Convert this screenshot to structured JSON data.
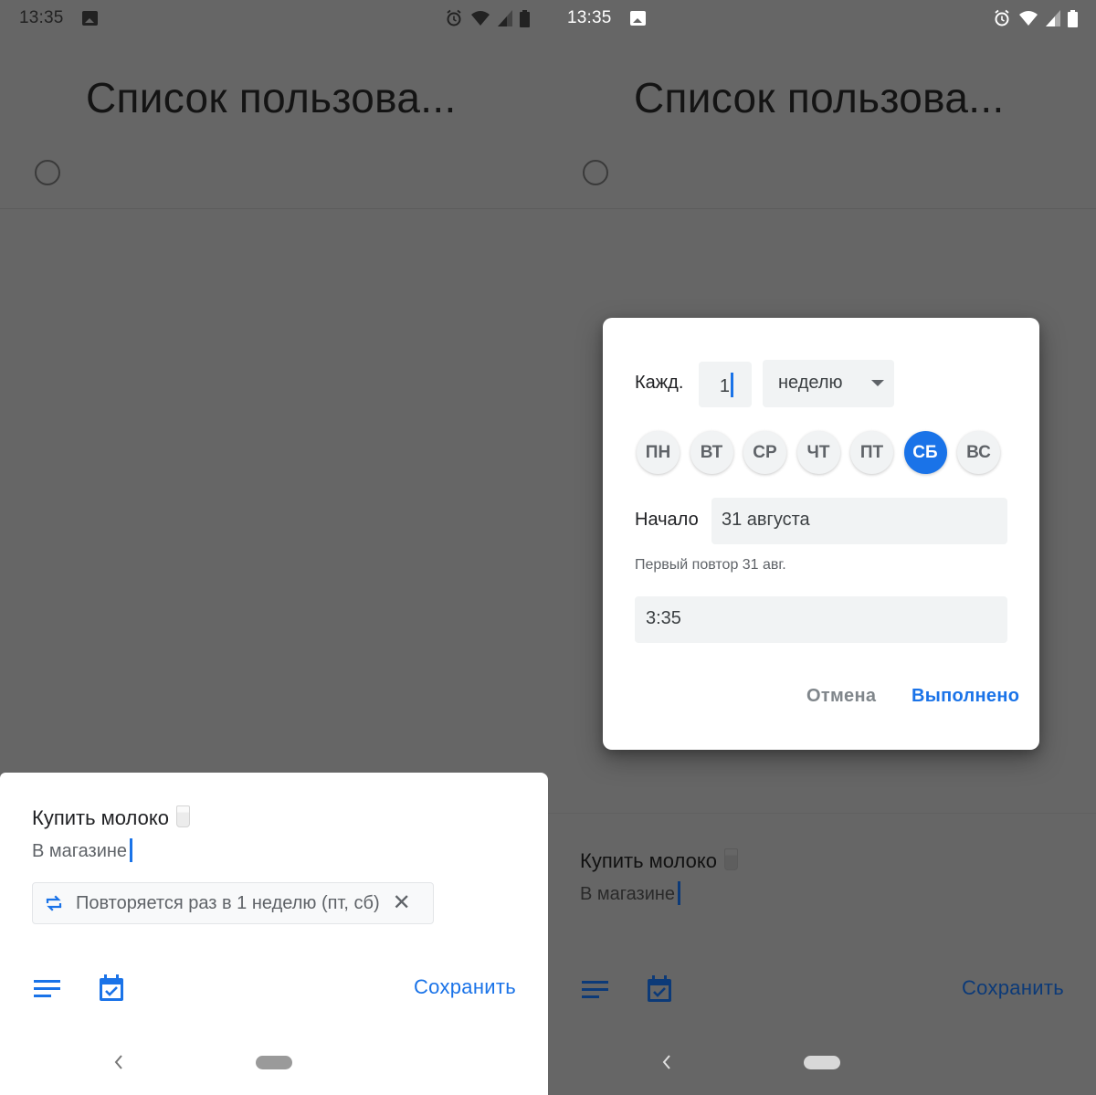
{
  "colors": {
    "accent": "#1a73e8",
    "scrim": "#666666",
    "chip_background": "#f1f3f4",
    "text_primary": "#202124",
    "text_secondary": "#5f6368"
  },
  "panels": [
    {
      "status_bar": {
        "time": "13:35",
        "icons": [
          "image-icon",
          "alarm-icon",
          "wifi-icon",
          "signal-icon",
          "battery-icon"
        ]
      },
      "list_title": "Список пользова...",
      "sheet": {
        "task_title": "Купить молоко",
        "task_emoji": "glass-of-milk-icon",
        "notes": "В магазине",
        "repeat_chip": {
          "icon": "repeat-icon",
          "label": "Повторяется раз в 1 неделю (пт, сб)",
          "close": "✕"
        },
        "toolbar": {
          "details_icon": "details-icon",
          "date_icon": "calendar-check-icon",
          "save_label": "Сохранить"
        }
      },
      "nav": {
        "back": "back-icon",
        "home": "home-pill"
      }
    },
    {
      "status_bar": {
        "time": "13:35",
        "icons": [
          "image-icon",
          "alarm-icon",
          "wifi-icon",
          "signal-icon",
          "battery-icon"
        ]
      },
      "list_title": "Список пользова...",
      "sheet": {
        "task_title": "Купить молоко",
        "task_emoji": "glass-of-milk-icon",
        "notes": "В магазине",
        "toolbar": {
          "details_icon": "details-icon",
          "date_icon": "calendar-check-icon",
          "save_label": "Сохранить"
        }
      },
      "dialog": {
        "every_label": "Кажд.",
        "interval_value": "1",
        "unit_selected": "неделю",
        "days": [
          {
            "label": "ПН",
            "selected": false
          },
          {
            "label": "ВТ",
            "selected": false
          },
          {
            "label": "СР",
            "selected": false
          },
          {
            "label": "ЧТ",
            "selected": false
          },
          {
            "label": "ПТ",
            "selected": false
          },
          {
            "label": "СБ",
            "selected": true
          },
          {
            "label": "ВС",
            "selected": false
          }
        ],
        "start_label": "Начало",
        "start_value": "31 августа",
        "first_repeat_text": "Первый повтор 31 авг.",
        "time_value": "3:35",
        "cancel_label": "Отмена",
        "done_label": "Выполнено"
      },
      "nav": {
        "back": "back-icon",
        "home": "home-pill"
      }
    }
  ]
}
